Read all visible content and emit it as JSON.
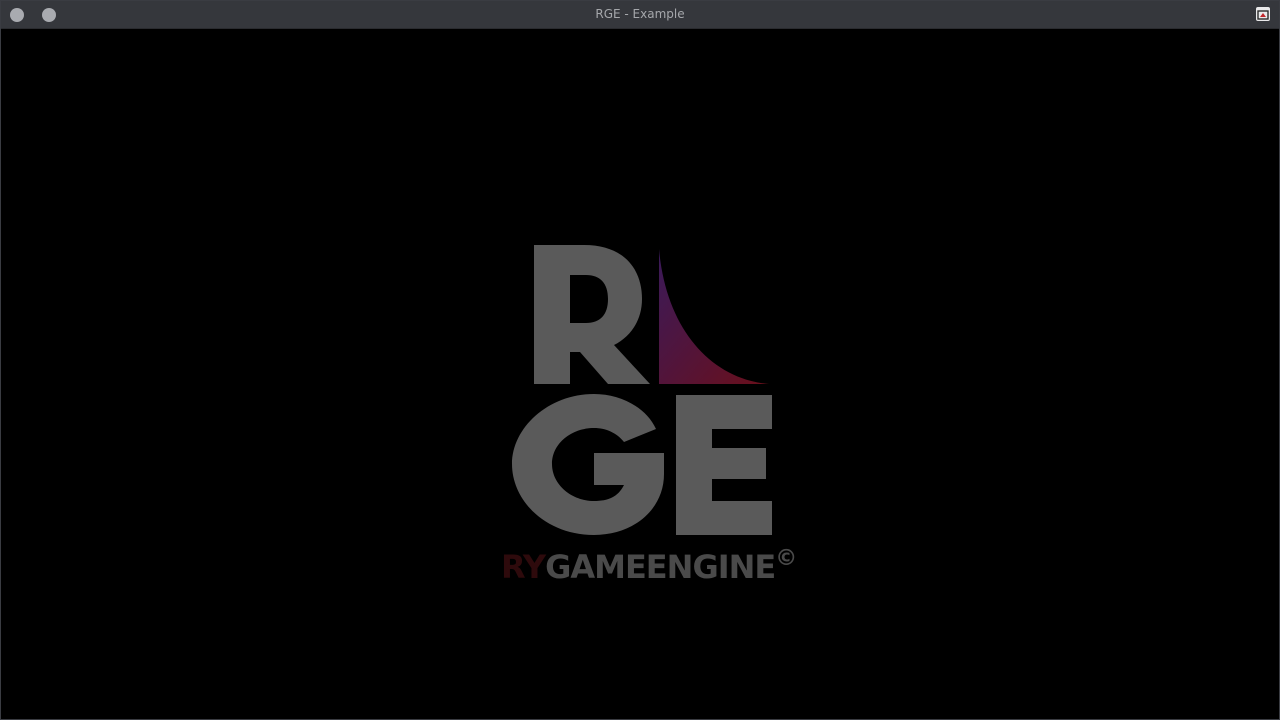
{
  "window": {
    "title": "RGE - Example"
  },
  "titlebar_buttons": {
    "close_icon": "circle-button",
    "minimize_icon": "circle-button",
    "app_icon": "app-icon"
  },
  "logo": {
    "letters_top": "R",
    "letters_bottom": "GE",
    "wordmark_prefix": "RY",
    "wordmark_rest": "GAMEENGINE",
    "wordmark_symbol": "©",
    "colors": {
      "letters": "#5a5a5a",
      "accent_top": "#3a1a5a",
      "accent_bottom": "#6a0f1a",
      "wordmark_prefix": "#2e0a0c",
      "wordmark_rest": "#4a4a4a"
    }
  }
}
